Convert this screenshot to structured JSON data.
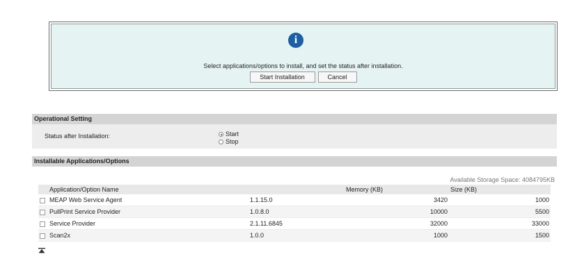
{
  "dialog": {
    "icon": "info-icon",
    "message": "Select applications/options to install, and set the status after installation.",
    "start_label": "Start Installation",
    "cancel_label": "Cancel"
  },
  "operational": {
    "header": "Operational Setting",
    "status_label": "Status after Installation:",
    "options": [
      {
        "label": "Start",
        "selected": true
      },
      {
        "label": "Stop",
        "selected": false
      }
    ]
  },
  "installable": {
    "header": "Installable Applications/Options",
    "available_storage": "Available Storage Space: 4084795KB",
    "columns": [
      "Application/Option Name",
      "",
      "Memory (KB)",
      "Size (KB)"
    ],
    "rows": [
      {
        "name": "MEAP Web Service Agent",
        "version": "1.1.15.0",
        "memory": "3420",
        "size": "1000"
      },
      {
        "name": "PullPrint Service Provider",
        "version": "1.0.8.0",
        "memory": "10000",
        "size": "5500"
      },
      {
        "name": "Service Provider",
        "version": "2.1.11.6845",
        "memory": "32000",
        "size": "33000"
      },
      {
        "name": "Scan2x",
        "version": "1.0.0",
        "memory": "1000",
        "size": "1500"
      }
    ]
  },
  "footer": {
    "top_icon": "scroll-top-icon"
  }
}
